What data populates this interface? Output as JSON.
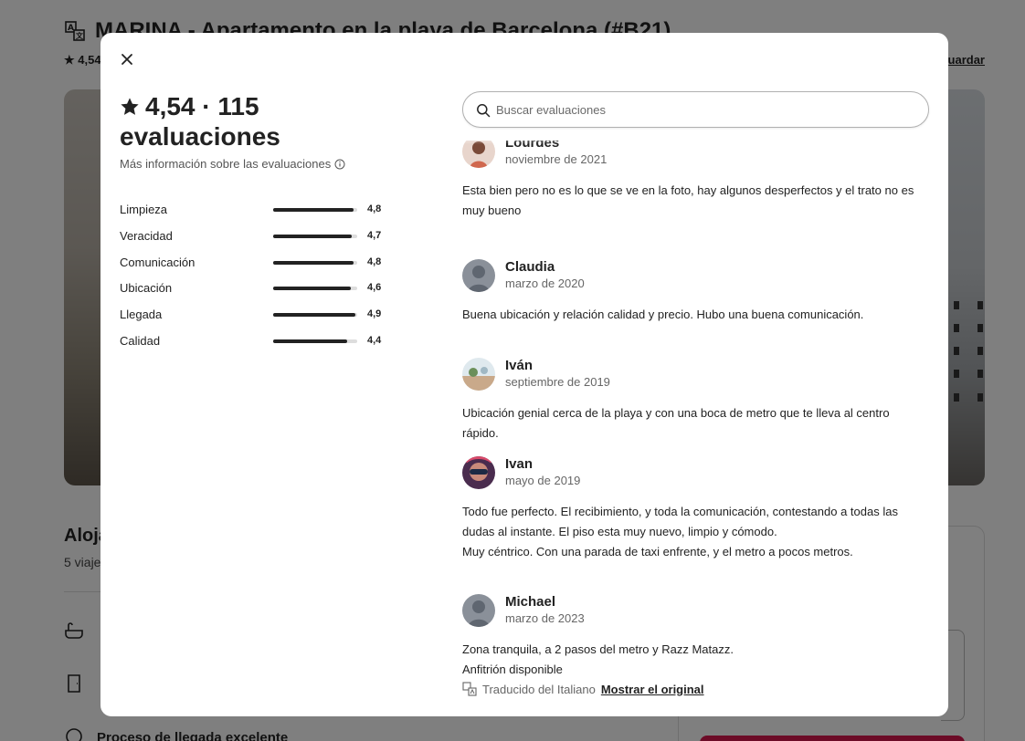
{
  "background": {
    "title": "MARINA - Apartamento en la playa de Barcelona (#B21)",
    "rating_prefix": "4,54",
    "save_label": "Guardar",
    "heading_fragment": "Aloja",
    "sub_fragment": "5 viaje",
    "arrival_label": "Proceso de llegada excelente"
  },
  "modal": {
    "summary": {
      "rating": "4,54 · 115",
      "count_label": "evaluaciones",
      "more_info": "Más información sobre las evaluaciones"
    },
    "categories": [
      {
        "label": "Limpieza",
        "value": "4,8",
        "fill": 0.96
      },
      {
        "label": "Veracidad",
        "value": "4,7",
        "fill": 0.94
      },
      {
        "label": "Comunicación",
        "value": "4,8",
        "fill": 0.96
      },
      {
        "label": "Ubicación",
        "value": "4,6",
        "fill": 0.92
      },
      {
        "label": "Llegada",
        "value": "4,9",
        "fill": 0.98
      },
      {
        "label": "Calidad",
        "value": "4,4",
        "fill": 0.88
      }
    ],
    "search": {
      "placeholder": "Buscar evaluaciones"
    },
    "reviews": [
      {
        "name": "Lourdes",
        "date": "noviembre de 2021",
        "text": [
          "Esta bien pero no es lo que se ve en la foto, hay algunos desperfectos y el trato no es",
          "muy bueno"
        ]
      },
      {
        "name": "Claudia",
        "date": "marzo de 2020",
        "text": [
          "Buena ubicación y relación calidad y precio. Hubo una buena comunicación."
        ]
      },
      {
        "name": "Iván",
        "date": "septiembre de 2019",
        "text": [
          "Ubicación genial cerca de la playa y con una boca de metro que te lleva al centro rápido."
        ]
      },
      {
        "name": "Ivan",
        "date": "mayo de 2019",
        "text": [
          "Todo fue perfecto. El recibimiento, y toda la comunicación, contestando a todas las",
          "dudas al instante. El piso esta muy nuevo, limpio y cómodo.",
          "Muy céntrico. Con una parada de taxi enfrente, y el metro a pocos metros."
        ]
      },
      {
        "name": "Michael",
        "date": "marzo de 2023",
        "text": [
          "Zona tranquila, a 2 pasos del metro y Razz Matazz.",
          "Anfitrión disponible"
        ],
        "translated_label": "Traducido del Italiano",
        "show_original": "Mostrar el original"
      }
    ]
  },
  "colors": {
    "overlay": "#00000080",
    "accent": "#d9174f",
    "text": "#222222"
  }
}
